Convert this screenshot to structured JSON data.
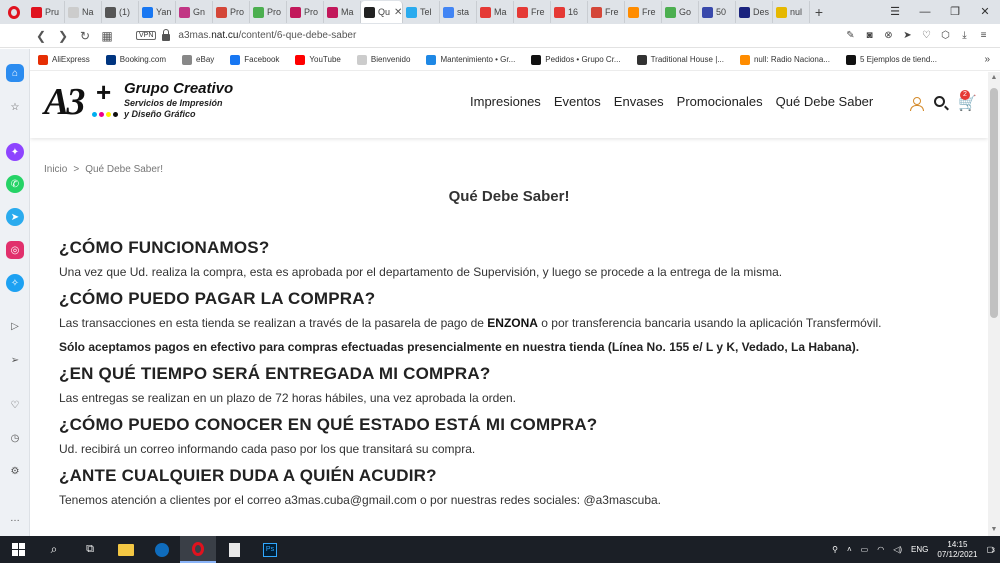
{
  "browser": {
    "tabs": [
      {
        "label": "Pru",
        "color": "#e0121e"
      },
      {
        "label": "Na",
        "color": "#cccccc"
      },
      {
        "label": "(1)",
        "color": "#555555"
      },
      {
        "label": "Yan",
        "color": "#1877f2"
      },
      {
        "label": "Gn",
        "color": "#c13584"
      },
      {
        "label": "Pro",
        "color": "#d44638"
      },
      {
        "label": "Pro",
        "color": "#4caf50"
      },
      {
        "label": "Pro",
        "color": "#c2185b"
      },
      {
        "label": "Ma",
        "color": "#c2185b"
      },
      {
        "label": "Qu",
        "color": "#222222",
        "active": true
      },
      {
        "label": "Tel",
        "color": "#2aabee"
      },
      {
        "label": "sta",
        "color": "#4285f4"
      },
      {
        "label": "Ma",
        "color": "#e53935"
      },
      {
        "label": "Fre",
        "color": "#e53935"
      },
      {
        "label": "16",
        "color": "#e53935"
      },
      {
        "label": "Fre",
        "color": "#d44638"
      },
      {
        "label": "Fre",
        "color": "#ff8c00"
      },
      {
        "label": "Go",
        "color": "#4caf50"
      },
      {
        "label": "50",
        "color": "#3949ab"
      },
      {
        "label": "Des",
        "color": "#1a237e"
      },
      {
        "label": "nul",
        "color": "#e6b800"
      }
    ],
    "new_tab": "+",
    "url_prefix": "a3mas.",
    "url_domain": "nat.cu",
    "url_path": "/content/6-que-debe-saber",
    "vpn_label": "VPN"
  },
  "bookmarks": [
    {
      "label": "AliExpress",
      "color": "#e62e04"
    },
    {
      "label": "Booking.com",
      "color": "#003580"
    },
    {
      "label": "eBay",
      "color": "#888888"
    },
    {
      "label": "Facebook",
      "color": "#1877f2"
    },
    {
      "label": "YouTube",
      "color": "#ff0000"
    },
    {
      "label": "Bienvenido",
      "color": "#cccccc"
    },
    {
      "label": "Mantenimiento • Gr...",
      "color": "#1e88e5"
    },
    {
      "label": "Pedidos • Grupo Cr...",
      "color": "#111111"
    },
    {
      "label": "Traditional House |...",
      "color": "#333333"
    },
    {
      "label": "null: Radio Naciona...",
      "color": "#ff8c00"
    },
    {
      "label": "5 Ejemplos de tiend...",
      "color": "#111111"
    }
  ],
  "site": {
    "logo": {
      "mark": "A3",
      "name": "Grupo Creativo",
      "subtitle_1": "Servicios de Impresión",
      "subtitle_2": "y Diseño Gráfico",
      "dot_colors": [
        "#00aeef",
        "#ec008c",
        "#fff200",
        "#111111"
      ]
    },
    "nav": [
      "Impresiones",
      "Eventos",
      "Envases",
      "Promocionales",
      "Qué Debe Saber"
    ],
    "cart_count": "2",
    "breadcrumb": {
      "home": "Inicio",
      "sep": ">",
      "current": "Qué Debe Saber!"
    },
    "page_title": "Qué Debe Saber!",
    "faq": [
      {
        "q": "¿CÓMO FUNCIONAMOS?",
        "a": "Una vez que Ud. realiza la compra, esta es aprobada por el departamento de Supervisión, y luego se procede a la entrega de la misma."
      },
      {
        "q": "¿CÓMO PUEDO PAGAR LA COMPRA?",
        "a_before": "Las transacciones en esta tienda se realizan a través de la pasarela de pago de ",
        "a_bold": "ENZONA",
        "a_after": " o por transferencia bancaria usando la aplicación Transfermóvil.",
        "note": "Sólo aceptamos pagos en efectivo para compras efectuadas presencialmente en nuestra tienda (Línea No. 155 e/ L y K, Vedado, La Habana)."
      },
      {
        "q": "¿EN QUÉ TIEMPO SERÁ ENTREGADA MI COMPRA?",
        "a": "Las entregas se realizan en un plazo de 72 horas hábiles, una vez aprobada la orden."
      },
      {
        "q": "¿CÓMO PUEDO CONOCER EN QUÉ ESTADO ESTÁ MI COMPRA?",
        "a": "Ud. recibirá un correo informando cada paso por los que transitará su compra."
      },
      {
        "q": "¿ANTE CUALQUIER DUDA A QUIÉN ACUDIR?",
        "a_before": "Tenemos atención a clientes por el correo ",
        "a_email": "a3mas.cuba@gmail.com",
        "a_after": " o por nuestras redes sociales: @a3mascuba."
      }
    ]
  },
  "taskbar": {
    "language": "ENG",
    "time": "14:15",
    "date": "07/12/2021",
    "notifications": "3"
  }
}
